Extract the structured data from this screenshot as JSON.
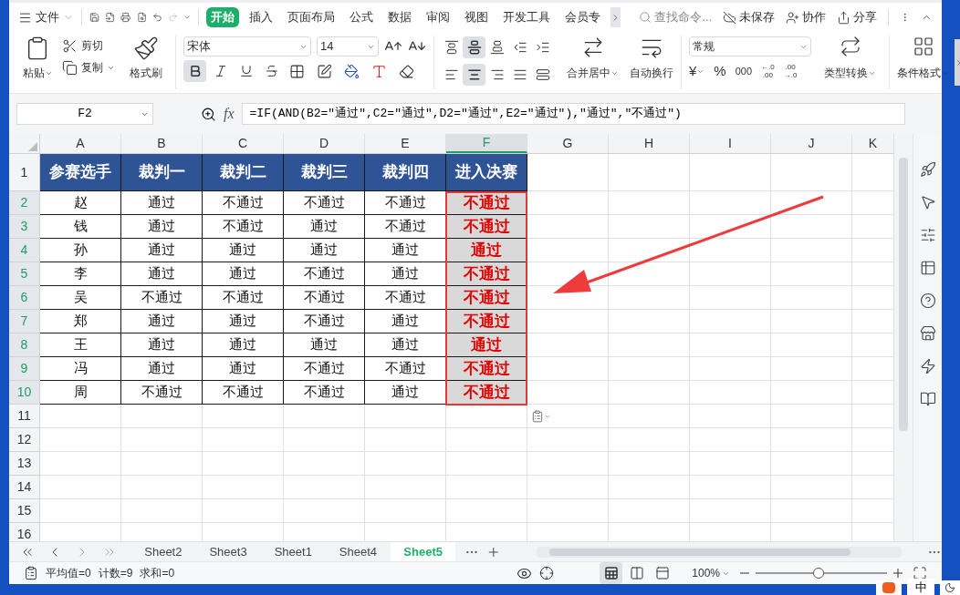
{
  "menu": {
    "file": "文件",
    "tabs": [
      {
        "label": "开始",
        "selected": true
      },
      {
        "label": "插入",
        "selected": false
      },
      {
        "label": "页面布局",
        "selected": false
      },
      {
        "label": "公式",
        "selected": false
      },
      {
        "label": "数据",
        "selected": false
      },
      {
        "label": "审阅",
        "selected": false
      },
      {
        "label": "视图",
        "selected": false
      },
      {
        "label": "开发工具",
        "selected": false
      },
      {
        "label": "会员专",
        "selected": false
      }
    ],
    "search": {
      "placeholder": "查找命令..."
    },
    "actions": [
      "未保存",
      "协作",
      "分享"
    ]
  },
  "ribbon": {
    "paste": "粘贴",
    "cut": "剪切",
    "copy": "复制",
    "format_painter": "格式刷",
    "font": "宋体",
    "font_size": "14",
    "styles": [
      {
        "kind": "bold",
        "selected": true
      },
      {
        "kind": "italic",
        "selected": false
      },
      {
        "kind": "underline",
        "selected": false
      },
      {
        "kind": "strike",
        "selected": false
      }
    ],
    "align_top": [
      {
        "kind": "top",
        "selected": false
      },
      {
        "kind": "middle",
        "selected": true
      },
      {
        "kind": "bottom",
        "selected": false
      },
      {
        "kind": "outdent",
        "selected": false
      },
      {
        "kind": "indent",
        "selected": false
      }
    ],
    "align_bottom": [
      {
        "kind": "left",
        "selected": false
      },
      {
        "kind": "center",
        "selected": true
      },
      {
        "kind": "right",
        "selected": false
      },
      {
        "kind": "justify",
        "selected": false
      },
      {
        "kind": "distribute",
        "selected": false
      }
    ],
    "merge": "合并居中",
    "wrap": "自动换行",
    "number_format": "常规",
    "currency": "¥",
    "percent": "%",
    "thousands": "000",
    "decimal_add": [
      "←.0",
      ".00"
    ],
    "decimal_remove": [
      ".00",
      "→.0"
    ],
    "convert": "类型转换",
    "conditional": "条件格式"
  },
  "formula_bar": {
    "name_box": "F2",
    "function_label": "fx",
    "formula": "=IF(AND(B2=\"通过\",C2=\"通过\",D2=\"通过\",E2=\"通过\"),\"通过\",\"不通过\")"
  },
  "sheet": {
    "columns": [
      {
        "letter": "A",
        "selected": false
      },
      {
        "letter": "B",
        "selected": false
      },
      {
        "letter": "C",
        "selected": false
      },
      {
        "letter": "D",
        "selected": false
      },
      {
        "letter": "E",
        "selected": false
      },
      {
        "letter": "F",
        "selected": true
      },
      {
        "letter": "G",
        "selected": false
      },
      {
        "letter": "H",
        "selected": false
      },
      {
        "letter": "I",
        "selected": false
      },
      {
        "letter": "J",
        "selected": false
      },
      {
        "letter": "K",
        "selected": false
      }
    ],
    "rows": [
      {
        "number": "1",
        "kind": "header",
        "selected": false,
        "cells": [
          "参赛选手",
          "裁判一",
          "裁判二",
          "裁判三",
          "裁判四",
          "进入决赛"
        ]
      },
      {
        "number": "2",
        "kind": "data",
        "selected": true,
        "cells": [
          "赵",
          "通过",
          "不通过",
          "不通过",
          "不通过",
          "不通过"
        ]
      },
      {
        "number": "3",
        "kind": "data",
        "selected": true,
        "cells": [
          "钱",
          "通过",
          "不通过",
          "通过",
          "不通过",
          "不通过"
        ]
      },
      {
        "number": "4",
        "kind": "data",
        "selected": true,
        "cells": [
          "孙",
          "通过",
          "通过",
          "通过",
          "通过",
          "通过"
        ]
      },
      {
        "number": "5",
        "kind": "data",
        "selected": true,
        "cells": [
          "李",
          "通过",
          "通过",
          "不通过",
          "通过",
          "不通过"
        ]
      },
      {
        "number": "6",
        "kind": "data",
        "selected": true,
        "cells": [
          "吴",
          "不通过",
          "不通过",
          "不通过",
          "不通过",
          "不通过"
        ]
      },
      {
        "number": "7",
        "kind": "data",
        "selected": true,
        "cells": [
          "郑",
          "通过",
          "通过",
          "不通过",
          "通过",
          "不通过"
        ]
      },
      {
        "number": "8",
        "kind": "data",
        "selected": true,
        "cells": [
          "王",
          "通过",
          "通过",
          "通过",
          "通过",
          "通过"
        ]
      },
      {
        "number": "9",
        "kind": "data",
        "selected": true,
        "cells": [
          "冯",
          "通过",
          "通过",
          "不通过",
          "不通过",
          "不通过"
        ]
      },
      {
        "number": "10",
        "kind": "data",
        "selected": true,
        "cells": [
          "周",
          "不通过",
          "不通过",
          "不通过",
          "通过",
          "不通过"
        ]
      },
      {
        "number": "11",
        "kind": "empty",
        "selected": false,
        "cells": []
      },
      {
        "number": "12",
        "kind": "empty",
        "selected": false,
        "cells": []
      },
      {
        "number": "13",
        "kind": "empty",
        "selected": false,
        "cells": []
      },
      {
        "number": "14",
        "kind": "empty",
        "selected": false,
        "cells": []
      },
      {
        "number": "15",
        "kind": "empty",
        "selected": false,
        "cells": []
      },
      {
        "number": "16",
        "kind": "empty",
        "selected": false,
        "cells": []
      }
    ]
  },
  "sheet_tabs": [
    {
      "label": "Sheet2",
      "selected": false
    },
    {
      "label": "Sheet3",
      "selected": false
    },
    {
      "label": "Sheet1",
      "selected": false
    },
    {
      "label": "Sheet4",
      "selected": false
    },
    {
      "label": "Sheet5",
      "selected": true
    }
  ],
  "status_bar": {
    "stats": [
      "平均值=0",
      "计数=9",
      "求和=0"
    ],
    "views": [
      {
        "kind": "normal",
        "selected": true
      },
      {
        "kind": "page",
        "selected": false
      },
      {
        "kind": "break",
        "selected": false
      }
    ],
    "zoom": "100%",
    "zoom_slider": {
      "level": 0.48
    }
  },
  "taskbar": {
    "ime": "中"
  }
}
